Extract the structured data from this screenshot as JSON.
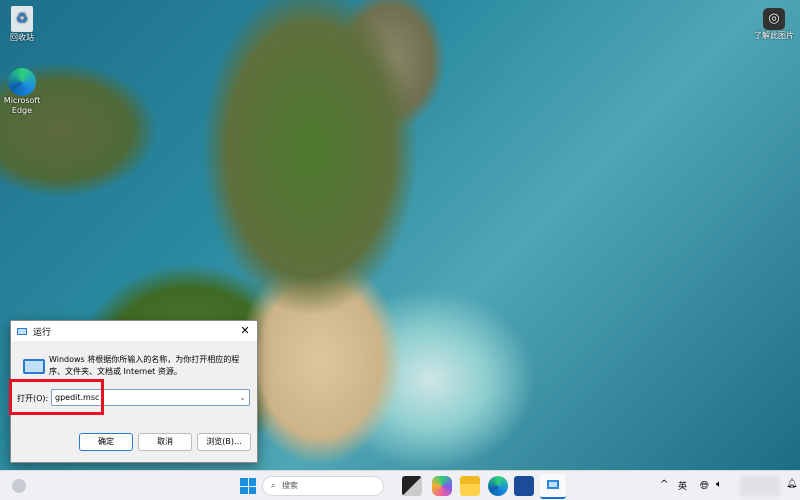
{
  "desktop": {
    "icons": [
      {
        "label": "回收站",
        "icon": "recycle-bin-icon"
      },
      {
        "label": "Microsoft Edge",
        "icon": "edge-icon"
      }
    ],
    "spotlight_label": "了解此图片"
  },
  "run_dialog": {
    "title": "运行",
    "description": "Windows 将根据你所输入的名称，为你打开相应的程序、文件夹、文档或 Internet 资源。",
    "open_label": "打开(O):",
    "open_value": "gpedit.msc",
    "ok": "确定",
    "cancel": "取消",
    "browse": "浏览(B)...",
    "highlight_color": "#e81123"
  },
  "taskbar": {
    "search_placeholder": "搜索",
    "ime": "英",
    "apps": [
      "start",
      "task-view",
      "copilot",
      "file-explorer",
      "edge",
      "store",
      "run"
    ]
  }
}
